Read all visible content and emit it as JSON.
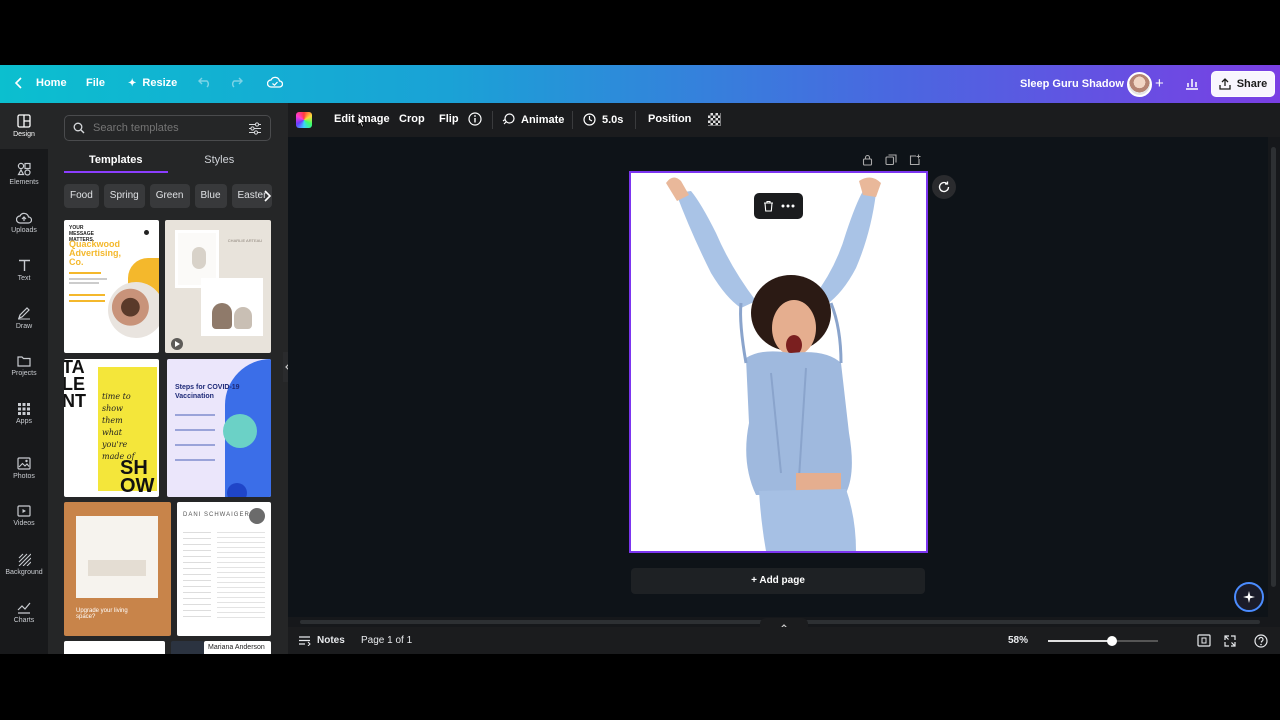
{
  "topbar": {
    "home_label": "Home",
    "file_label": "File",
    "resize_label": "Resize",
    "design_title": "Sleep Guru Shadow",
    "share_label": "Share"
  },
  "rail": {
    "items": [
      {
        "label": "Design",
        "icon": "design-icon"
      },
      {
        "label": "Elements",
        "icon": "elements-icon"
      },
      {
        "label": "Uploads",
        "icon": "uploads-icon"
      },
      {
        "label": "Text",
        "icon": "text-icon"
      },
      {
        "label": "Draw",
        "icon": "draw-icon"
      },
      {
        "label": "Projects",
        "icon": "projects-icon"
      },
      {
        "label": "Apps",
        "icon": "apps-icon"
      },
      {
        "label": "Photos",
        "icon": "photos-icon"
      },
      {
        "label": "Videos",
        "icon": "videos-icon"
      },
      {
        "label": "Background",
        "icon": "background-icon"
      },
      {
        "label": "Charts",
        "icon": "charts-icon"
      }
    ]
  },
  "panel": {
    "search_placeholder": "Search templates",
    "tabs": [
      {
        "label": "Templates"
      },
      {
        "label": "Styles"
      }
    ],
    "chips": [
      {
        "label": "Food"
      },
      {
        "label": "Spring"
      },
      {
        "label": "Green"
      },
      {
        "label": "Blue"
      },
      {
        "label": "Easter"
      }
    ],
    "templates": {
      "t1_top": "YOUR MESSAGE MATTERS.",
      "t1_title": "Quackwood Advertising, Co.",
      "t2_title": "CHARLIE ARTEAU",
      "t3_big": "TA LE NT",
      "t3_script": "time to show them what you're made of",
      "t3_show": "SH OW",
      "t4_title": "Steps for COVID-19 Vaccination",
      "t6_name": "DANI SCHWAIGER",
      "t5_caption": "Upgrade your living space?",
      "t8_name": "Mariana Anderson"
    }
  },
  "toolbar": {
    "edit_image": "Edit Image",
    "crop": "Crop",
    "flip": "Flip",
    "animate": "Animate",
    "duration": "5.0s",
    "position": "Position"
  },
  "canvas": {
    "add_page": "+ Add page"
  },
  "bottombar": {
    "notes": "Notes",
    "page_indicator": "Page 1 of 1",
    "zoom": "58%",
    "zoom_fraction": 0.58
  },
  "colors": {
    "accent": "#8b3dff",
    "page_border": "#7c35f0"
  }
}
